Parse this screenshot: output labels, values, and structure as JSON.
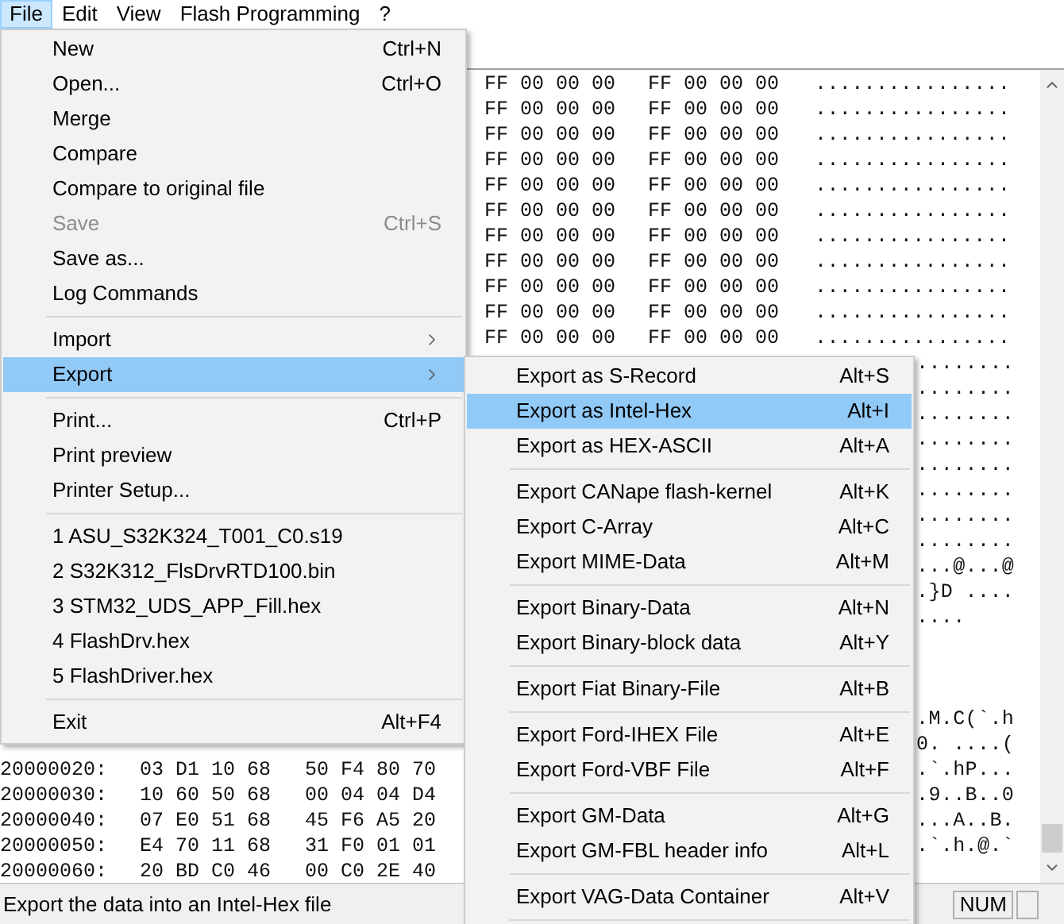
{
  "menu_bar": [
    {
      "label": "File",
      "selected": true
    },
    {
      "label": "Edit",
      "selected": false
    },
    {
      "label": "View",
      "selected": false
    },
    {
      "label": "Flash Programming",
      "selected": false
    },
    {
      "label": "?",
      "selected": false
    }
  ],
  "file_menu": {
    "items": [
      {
        "kind": "item",
        "label": "New",
        "shortcut": "Ctrl+N",
        "disabled": false,
        "selected": false,
        "submenu": false
      },
      {
        "kind": "item",
        "label": "Open...",
        "shortcut": "Ctrl+O",
        "disabled": false,
        "selected": false,
        "submenu": false
      },
      {
        "kind": "item",
        "label": "Merge",
        "disabled": false,
        "selected": false,
        "submenu": false
      },
      {
        "kind": "item",
        "label": "Compare",
        "disabled": false,
        "selected": false,
        "submenu": false
      },
      {
        "kind": "item",
        "label": "Compare to original file",
        "disabled": false,
        "selected": false,
        "submenu": false
      },
      {
        "kind": "item",
        "label": "Save",
        "shortcut": "Ctrl+S",
        "disabled": true,
        "selected": false,
        "submenu": false
      },
      {
        "kind": "item",
        "label": "Save as...",
        "disabled": false,
        "selected": false,
        "submenu": false
      },
      {
        "kind": "item",
        "label": "Log Commands",
        "disabled": false,
        "selected": false,
        "submenu": false
      },
      {
        "kind": "separator"
      },
      {
        "kind": "item",
        "label": "Import",
        "disabled": false,
        "selected": false,
        "submenu": true
      },
      {
        "kind": "item",
        "label": "Export",
        "disabled": false,
        "selected": true,
        "submenu": true
      },
      {
        "kind": "separator"
      },
      {
        "kind": "item",
        "label": "Print...",
        "shortcut": "Ctrl+P",
        "disabled": false,
        "selected": false,
        "submenu": false
      },
      {
        "kind": "item",
        "label": "Print preview",
        "disabled": false,
        "selected": false,
        "submenu": false
      },
      {
        "kind": "item",
        "label": "Printer Setup...",
        "disabled": false,
        "selected": false,
        "submenu": false
      },
      {
        "kind": "separator"
      },
      {
        "kind": "item",
        "label": "1 ASU_S32K324_T001_C0.s19",
        "disabled": false,
        "selected": false,
        "submenu": false
      },
      {
        "kind": "item",
        "label": "2 S32K312_FlsDrvRTD100.bin",
        "disabled": false,
        "selected": false,
        "submenu": false
      },
      {
        "kind": "item",
        "label": "3 STM32_UDS_APP_Fill.hex",
        "disabled": false,
        "selected": false,
        "submenu": false
      },
      {
        "kind": "item",
        "label": "4 FlashDrv.hex",
        "disabled": false,
        "selected": false,
        "submenu": false
      },
      {
        "kind": "item",
        "label": "5 FlashDriver.hex",
        "disabled": false,
        "selected": false,
        "submenu": false
      },
      {
        "kind": "separator"
      },
      {
        "kind": "item",
        "label": "Exit",
        "shortcut": "Alt+F4",
        "disabled": false,
        "selected": false,
        "submenu": false
      }
    ]
  },
  "export_submenu": {
    "items": [
      {
        "kind": "item",
        "label": "Export as S-Record",
        "shortcut": "Alt+S",
        "disabled": false,
        "selected": false,
        "submenu": false
      },
      {
        "kind": "item",
        "label": "Export as Intel-Hex",
        "shortcut": "Alt+I",
        "disabled": false,
        "selected": true,
        "submenu": false
      },
      {
        "kind": "item",
        "label": "Export as HEX-ASCII",
        "shortcut": "Alt+A",
        "disabled": false,
        "selected": false,
        "submenu": false
      },
      {
        "kind": "separator"
      },
      {
        "kind": "item",
        "label": "Export CANape flash-kernel",
        "shortcut": "Alt+K",
        "disabled": false,
        "selected": false,
        "submenu": false
      },
      {
        "kind": "item",
        "label": "Export C-Array",
        "shortcut": "Alt+C",
        "disabled": false,
        "selected": false,
        "submenu": false
      },
      {
        "kind": "item",
        "label": "Export MIME-Data",
        "shortcut": "Alt+M",
        "disabled": false,
        "selected": false,
        "submenu": false
      },
      {
        "kind": "separator"
      },
      {
        "kind": "item",
        "label": "Export Binary-Data",
        "shortcut": "Alt+N",
        "disabled": false,
        "selected": false,
        "submenu": false
      },
      {
        "kind": "item",
        "label": "Export Binary-block data",
        "shortcut": "Alt+Y",
        "disabled": false,
        "selected": false,
        "submenu": false
      },
      {
        "kind": "separator"
      },
      {
        "kind": "item",
        "label": "Export Fiat Binary-File",
        "shortcut": "Alt+B",
        "disabled": false,
        "selected": false,
        "submenu": false
      },
      {
        "kind": "separator"
      },
      {
        "kind": "item",
        "label": "Export Ford-IHEX File",
        "shortcut": "Alt+E",
        "disabled": false,
        "selected": false,
        "submenu": false
      },
      {
        "kind": "item",
        "label": "Export Ford-VBF File",
        "shortcut": "Alt+F",
        "disabled": false,
        "selected": false,
        "submenu": false
      },
      {
        "kind": "separator"
      },
      {
        "kind": "item",
        "label": "Export GM-Data",
        "shortcut": "Alt+G",
        "disabled": false,
        "selected": false,
        "submenu": false
      },
      {
        "kind": "item",
        "label": "Export GM-FBL header info",
        "shortcut": "Alt+L",
        "disabled": false,
        "selected": false,
        "submenu": false
      },
      {
        "kind": "separator"
      },
      {
        "kind": "item",
        "label": "Export VAG-Data Container",
        "shortcut": "Alt+V",
        "disabled": false,
        "selected": false,
        "submenu": false
      },
      {
        "kind": "separator"
      }
    ]
  },
  "hex_view": {
    "rows": [
      {
        "bytes_right": [
          "FF 00 00 00",
          "FF 00 00 00"
        ],
        "ascii": "................"
      },
      {
        "bytes_right": [
          "FF 00 00 00",
          "FF 00 00 00"
        ],
        "ascii": "................"
      },
      {
        "bytes_right": [
          "FF 00 00 00",
          "FF 00 00 00"
        ],
        "ascii": "................"
      },
      {
        "bytes_right": [
          "FF 00 00 00",
          "FF 00 00 00"
        ],
        "ascii": "................"
      },
      {
        "bytes_right": [
          "FF 00 00 00",
          "FF 00 00 00"
        ],
        "ascii": "................"
      },
      {
        "bytes_right": [
          "FF 00 00 00",
          "FF 00 00 00"
        ],
        "ascii": "................"
      },
      {
        "bytes_right": [
          "FF 00 00 00",
          "FF 00 00 00"
        ],
        "ascii": "................"
      },
      {
        "bytes_right": [
          "FF 00 00 00",
          "FF 00 00 00"
        ],
        "ascii": "................"
      },
      {
        "bytes_right": [
          "FF 00 00 00",
          "FF 00 00 00"
        ],
        "ascii": "................"
      },
      {
        "bytes_right": [
          "FF 00 00 00",
          "FF 00 00 00"
        ],
        "ascii": "................"
      },
      {
        "bytes_right": [
          "FF 00 00 00",
          "FF 00 00 00"
        ],
        "ascii": "................"
      },
      {
        "ascii_tail": "........"
      },
      {
        "ascii_tail": "........"
      },
      {
        "ascii_tail": "........"
      },
      {
        "ascii_tail": "........"
      },
      {
        "ascii_tail": "........"
      },
      {
        "ascii_tail": "........"
      },
      {
        "ascii_tail": "........"
      },
      {
        "ascii_tail": "........"
      },
      {
        "ascii_tail": "...@...@"
      },
      {
        "ascii_tail": ".}D ...."
      },
      {
        "ascii_tail": "...."
      },
      {},
      {},
      {},
      {
        "ascii_tail": ".M.C(`.h"
      },
      {
        "ascii_tail": "0. ....("
      },
      {
        "address": "20000020:",
        "bytes_left": [
          "03 D1 10 68",
          "50 F4 80 70"
        ],
        "ascii_tail": ".`.hP..."
      },
      {
        "address": "20000030:",
        "bytes_left": [
          "10 60 50 68",
          "00 04 04 D4"
        ],
        "ascii_tail": ".9..B..0"
      },
      {
        "address": "20000040:",
        "bytes_left": [
          "07 E0 51 68",
          "45 F6 A5 20"
        ],
        "ascii_tail": "...A..B."
      },
      {
        "address": "20000050:",
        "bytes_left": [
          "E4 70 11 68",
          "31 F0 01 01"
        ],
        "ascii_tail": ".`.h.@.`"
      },
      {
        "address": "20000060:",
        "bytes_left": [
          "20 BD C0 46",
          "00 C0 2E 40"
        ]
      }
    ]
  },
  "status_bar": {
    "message": "Export the data into an Intel-Hex file",
    "indicator": "NUM"
  }
}
